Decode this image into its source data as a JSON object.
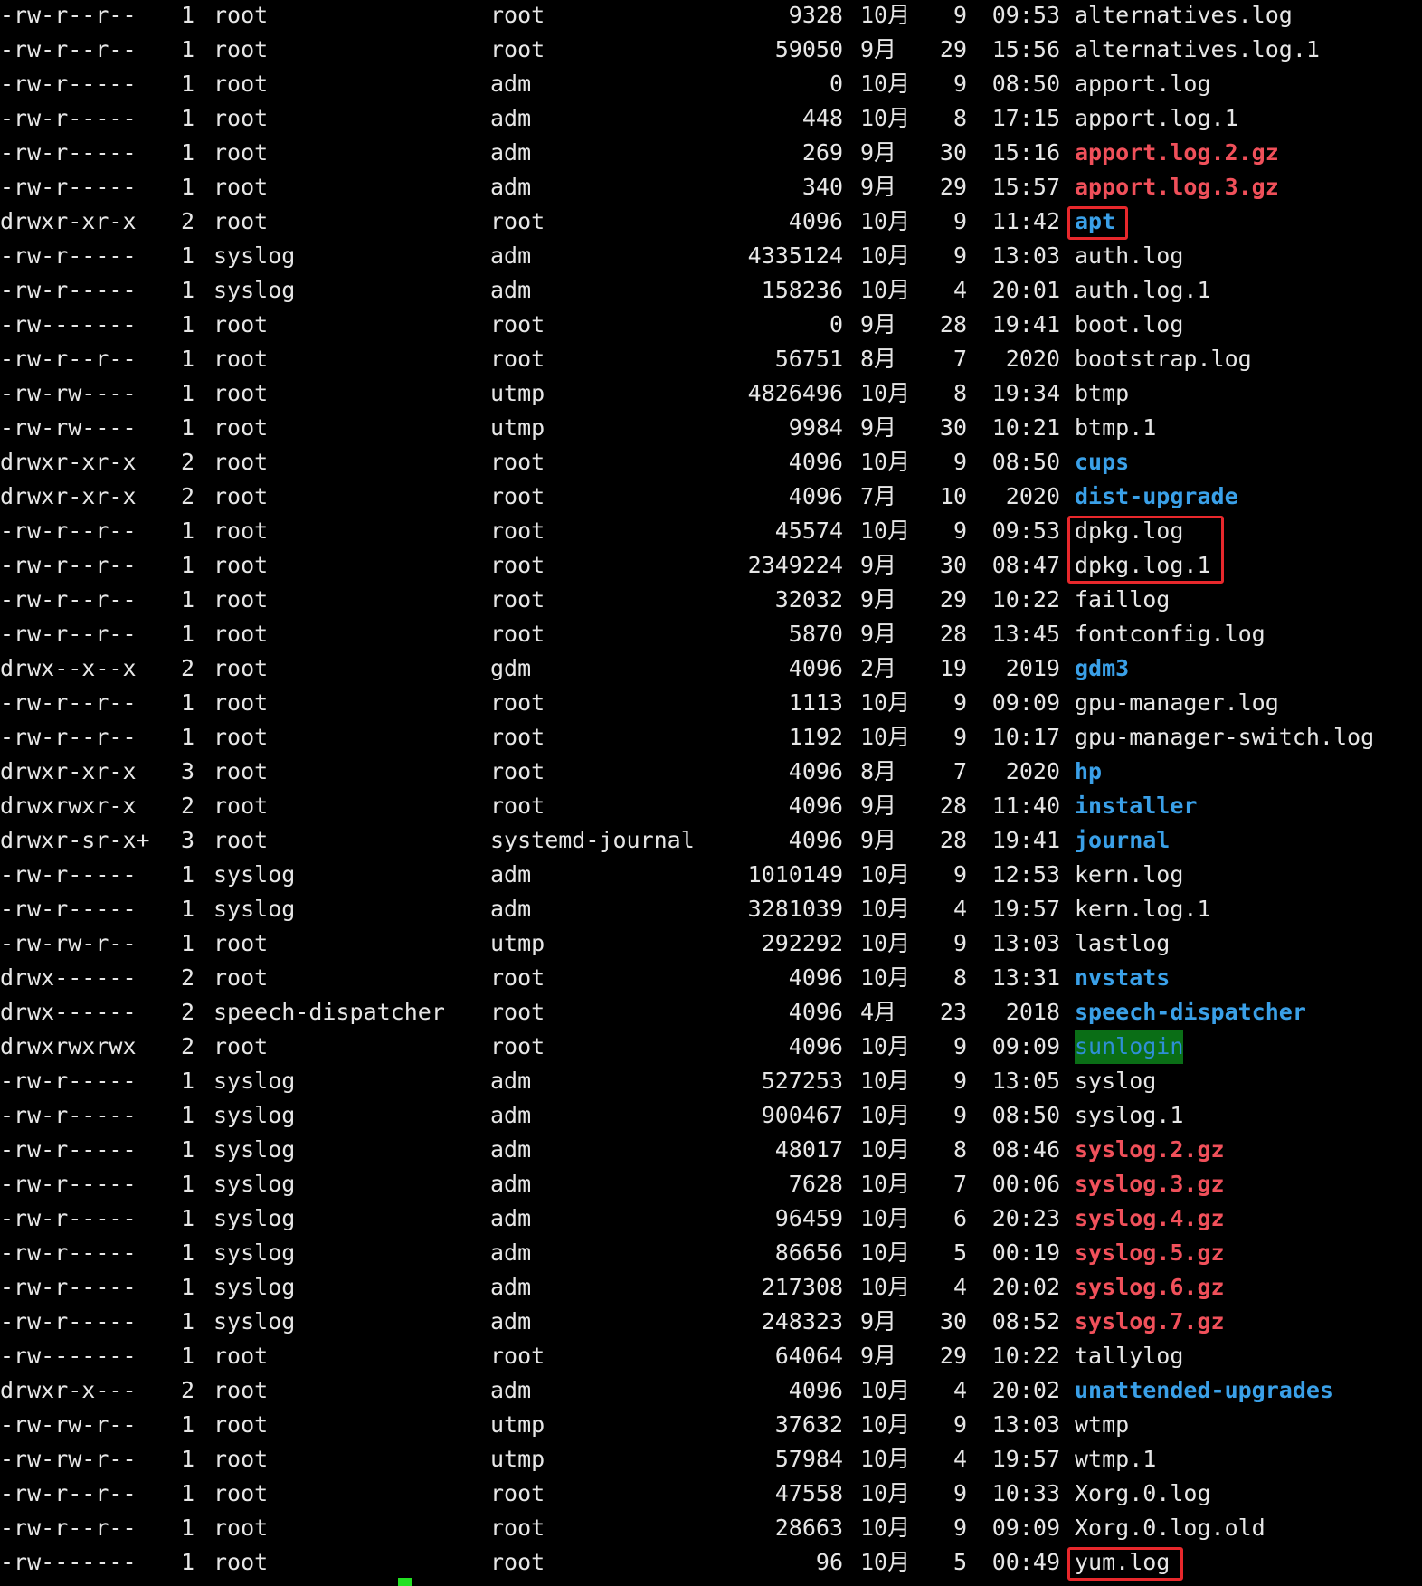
{
  "accent_colors": {
    "directory": "#3aa0e8",
    "archive": "#f0505a",
    "sticky_dir_bg": "#0a6e16",
    "highlight_box": "#e8282c",
    "cursor": "#22e022"
  },
  "listing": [
    {
      "perms": "-rw-r--r--",
      "links": "1",
      "owner": "root",
      "group": "root",
      "size": "9328",
      "month": "10月",
      "day": "9",
      "time": "09:53",
      "name": "alternatives.log",
      "type": "file"
    },
    {
      "perms": "-rw-r--r--",
      "links": "1",
      "owner": "root",
      "group": "root",
      "size": "59050",
      "month": "9月",
      "day": "29",
      "time": "15:56",
      "name": "alternatives.log.1",
      "type": "file"
    },
    {
      "perms": "-rw-r-----",
      "links": "1",
      "owner": "root",
      "group": "adm",
      "size": "0",
      "month": "10月",
      "day": "9",
      "time": "08:50",
      "name": "apport.log",
      "type": "file"
    },
    {
      "perms": "-rw-r-----",
      "links": "1",
      "owner": "root",
      "group": "adm",
      "size": "448",
      "month": "10月",
      "day": "8",
      "time": "17:15",
      "name": "apport.log.1",
      "type": "file"
    },
    {
      "perms": "-rw-r-----",
      "links": "1",
      "owner": "root",
      "group": "adm",
      "size": "269",
      "month": "9月",
      "day": "30",
      "time": "15:16",
      "name": "apport.log.2.gz",
      "type": "gz"
    },
    {
      "perms": "-rw-r-----",
      "links": "1",
      "owner": "root",
      "group": "adm",
      "size": "340",
      "month": "9月",
      "day": "29",
      "time": "15:57",
      "name": "apport.log.3.gz",
      "type": "gz"
    },
    {
      "perms": "drwxr-xr-x",
      "links": "2",
      "owner": "root",
      "group": "root",
      "size": "4096",
      "month": "10月",
      "day": "9",
      "time": "11:42",
      "name": "apt",
      "type": "dir"
    },
    {
      "perms": "-rw-r-----",
      "links": "1",
      "owner": "syslog",
      "group": "adm",
      "size": "4335124",
      "month": "10月",
      "day": "9",
      "time": "13:03",
      "name": "auth.log",
      "type": "file"
    },
    {
      "perms": "-rw-r-----",
      "links": "1",
      "owner": "syslog",
      "group": "adm",
      "size": "158236",
      "month": "10月",
      "day": "4",
      "time": "20:01",
      "name": "auth.log.1",
      "type": "file"
    },
    {
      "perms": "-rw-------",
      "links": "1",
      "owner": "root",
      "group": "root",
      "size": "0",
      "month": "9月",
      "day": "28",
      "time": "19:41",
      "name": "boot.log",
      "type": "file"
    },
    {
      "perms": "-rw-r--r--",
      "links": "1",
      "owner": "root",
      "group": "root",
      "size": "56751",
      "month": "8月",
      "day": "7",
      "time": "2020",
      "name": "bootstrap.log",
      "type": "file"
    },
    {
      "perms": "-rw-rw----",
      "links": "1",
      "owner": "root",
      "group": "utmp",
      "size": "4826496",
      "month": "10月",
      "day": "8",
      "time": "19:34",
      "name": "btmp",
      "type": "file"
    },
    {
      "perms": "-rw-rw----",
      "links": "1",
      "owner": "root",
      "group": "utmp",
      "size": "9984",
      "month": "9月",
      "day": "30",
      "time": "10:21",
      "name": "btmp.1",
      "type": "file"
    },
    {
      "perms": "drwxr-xr-x",
      "links": "2",
      "owner": "root",
      "group": "root",
      "size": "4096",
      "month": "10月",
      "day": "9",
      "time": "08:50",
      "name": "cups",
      "type": "dir"
    },
    {
      "perms": "drwxr-xr-x",
      "links": "2",
      "owner": "root",
      "group": "root",
      "size": "4096",
      "month": "7月",
      "day": "10",
      "time": "2020",
      "name": "dist-upgrade",
      "type": "dir"
    },
    {
      "perms": "-rw-r--r--",
      "links": "1",
      "owner": "root",
      "group": "root",
      "size": "45574",
      "month": "10月",
      "day": "9",
      "time": "09:53",
      "name": "dpkg.log",
      "type": "file"
    },
    {
      "perms": "-rw-r--r--",
      "links": "1",
      "owner": "root",
      "group": "root",
      "size": "2349224",
      "month": "9月",
      "day": "30",
      "time": "08:47",
      "name": "dpkg.log.1",
      "type": "file"
    },
    {
      "perms": "-rw-r--r--",
      "links": "1",
      "owner": "root",
      "group": "root",
      "size": "32032",
      "month": "9月",
      "day": "29",
      "time": "10:22",
      "name": "faillog",
      "type": "file"
    },
    {
      "perms": "-rw-r--r--",
      "links": "1",
      "owner": "root",
      "group": "root",
      "size": "5870",
      "month": "9月",
      "day": "28",
      "time": "13:45",
      "name": "fontconfig.log",
      "type": "file"
    },
    {
      "perms": "drwx--x--x",
      "links": "2",
      "owner": "root",
      "group": "gdm",
      "size": "4096",
      "month": "2月",
      "day": "19",
      "time": "2019",
      "name": "gdm3",
      "type": "dir"
    },
    {
      "perms": "-rw-r--r--",
      "links": "1",
      "owner": "root",
      "group": "root",
      "size": "1113",
      "month": "10月",
      "day": "9",
      "time": "09:09",
      "name": "gpu-manager.log",
      "type": "file"
    },
    {
      "perms": "-rw-r--r--",
      "links": "1",
      "owner": "root",
      "group": "root",
      "size": "1192",
      "month": "10月",
      "day": "9",
      "time": "10:17",
      "name": "gpu-manager-switch.log",
      "type": "file"
    },
    {
      "perms": "drwxr-xr-x",
      "links": "3",
      "owner": "root",
      "group": "root",
      "size": "4096",
      "month": "8月",
      "day": "7",
      "time": "2020",
      "name": "hp",
      "type": "dir"
    },
    {
      "perms": "drwxrwxr-x",
      "links": "2",
      "owner": "root",
      "group": "root",
      "size": "4096",
      "month": "9月",
      "day": "28",
      "time": "11:40",
      "name": "installer",
      "type": "dir"
    },
    {
      "perms": "drwxr-sr-x+",
      "links": "3",
      "owner": "root",
      "group": "systemd-journal",
      "size": "4096",
      "month": "9月",
      "day": "28",
      "time": "19:41",
      "name": "journal",
      "type": "dir"
    },
    {
      "perms": "-rw-r-----",
      "links": "1",
      "owner": "syslog",
      "group": "adm",
      "size": "1010149",
      "month": "10月",
      "day": "9",
      "time": "12:53",
      "name": "kern.log",
      "type": "file"
    },
    {
      "perms": "-rw-r-----",
      "links": "1",
      "owner": "syslog",
      "group": "adm",
      "size": "3281039",
      "month": "10月",
      "day": "4",
      "time": "19:57",
      "name": "kern.log.1",
      "type": "file"
    },
    {
      "perms": "-rw-rw-r--",
      "links": "1",
      "owner": "root",
      "group": "utmp",
      "size": "292292",
      "month": "10月",
      "day": "9",
      "time": "13:03",
      "name": "lastlog",
      "type": "file"
    },
    {
      "perms": "drwx------",
      "links": "2",
      "owner": "root",
      "group": "root",
      "size": "4096",
      "month": "10月",
      "day": "8",
      "time": "13:31",
      "name": "nvstats",
      "type": "dir"
    },
    {
      "perms": "drwx------",
      "links": "2",
      "owner": "speech-dispatcher",
      "group": "root",
      "size": "4096",
      "month": "4月",
      "day": "23",
      "time": "2018",
      "name": "speech-dispatcher",
      "type": "dir"
    },
    {
      "perms": "drwxrwxrwx",
      "links": "2",
      "owner": "root",
      "group": "root",
      "size": "4096",
      "month": "10月",
      "day": "9",
      "time": "09:09",
      "name": "sunlogin",
      "type": "sticky"
    },
    {
      "perms": "-rw-r-----",
      "links": "1",
      "owner": "syslog",
      "group": "adm",
      "size": "527253",
      "month": "10月",
      "day": "9",
      "time": "13:05",
      "name": "syslog",
      "type": "file"
    },
    {
      "perms": "-rw-r-----",
      "links": "1",
      "owner": "syslog",
      "group": "adm",
      "size": "900467",
      "month": "10月",
      "day": "9",
      "time": "08:50",
      "name": "syslog.1",
      "type": "file"
    },
    {
      "perms": "-rw-r-----",
      "links": "1",
      "owner": "syslog",
      "group": "adm",
      "size": "48017",
      "month": "10月",
      "day": "8",
      "time": "08:46",
      "name": "syslog.2.gz",
      "type": "gz"
    },
    {
      "perms": "-rw-r-----",
      "links": "1",
      "owner": "syslog",
      "group": "adm",
      "size": "7628",
      "month": "10月",
      "day": "7",
      "time": "00:06",
      "name": "syslog.3.gz",
      "type": "gz"
    },
    {
      "perms": "-rw-r-----",
      "links": "1",
      "owner": "syslog",
      "group": "adm",
      "size": "96459",
      "month": "10月",
      "day": "6",
      "time": "20:23",
      "name": "syslog.4.gz",
      "type": "gz"
    },
    {
      "perms": "-rw-r-----",
      "links": "1",
      "owner": "syslog",
      "group": "adm",
      "size": "86656",
      "month": "10月",
      "day": "5",
      "time": "00:19",
      "name": "syslog.5.gz",
      "type": "gz"
    },
    {
      "perms": "-rw-r-----",
      "links": "1",
      "owner": "syslog",
      "group": "adm",
      "size": "217308",
      "month": "10月",
      "day": "4",
      "time": "20:02",
      "name": "syslog.6.gz",
      "type": "gz"
    },
    {
      "perms": "-rw-r-----",
      "links": "1",
      "owner": "syslog",
      "group": "adm",
      "size": "248323",
      "month": "9月",
      "day": "30",
      "time": "08:52",
      "name": "syslog.7.gz",
      "type": "gz"
    },
    {
      "perms": "-rw-------",
      "links": "1",
      "owner": "root",
      "group": "root",
      "size": "64064",
      "month": "9月",
      "day": "29",
      "time": "10:22",
      "name": "tallylog",
      "type": "file"
    },
    {
      "perms": "drwxr-x---",
      "links": "2",
      "owner": "root",
      "group": "adm",
      "size": "4096",
      "month": "10月",
      "day": "4",
      "time": "20:02",
      "name": "unattended-upgrades",
      "type": "dir"
    },
    {
      "perms": "-rw-rw-r--",
      "links": "1",
      "owner": "root",
      "group": "utmp",
      "size": "37632",
      "month": "10月",
      "day": "9",
      "time": "13:03",
      "name": "wtmp",
      "type": "file"
    },
    {
      "perms": "-rw-rw-r--",
      "links": "1",
      "owner": "root",
      "group": "utmp",
      "size": "57984",
      "month": "10月",
      "day": "4",
      "time": "19:57",
      "name": "wtmp.1",
      "type": "file"
    },
    {
      "perms": "-rw-r--r--",
      "links": "1",
      "owner": "root",
      "group": "root",
      "size": "47558",
      "month": "10月",
      "day": "9",
      "time": "10:33",
      "name": "Xorg.0.log",
      "type": "file"
    },
    {
      "perms": "-rw-r--r--",
      "links": "1",
      "owner": "root",
      "group": "root",
      "size": "28663",
      "month": "10月",
      "day": "9",
      "time": "09:09",
      "name": "Xorg.0.log.old",
      "type": "file"
    },
    {
      "perms": "-rw-------",
      "links": "1",
      "owner": "root",
      "group": "root",
      "size": "96",
      "month": "10月",
      "day": "5",
      "time": "00:49",
      "name": "yum.log",
      "type": "file"
    }
  ],
  "highlighted_names": [
    "apt",
    "dpkg.log",
    "dpkg.log.1",
    "yum.log"
  ]
}
